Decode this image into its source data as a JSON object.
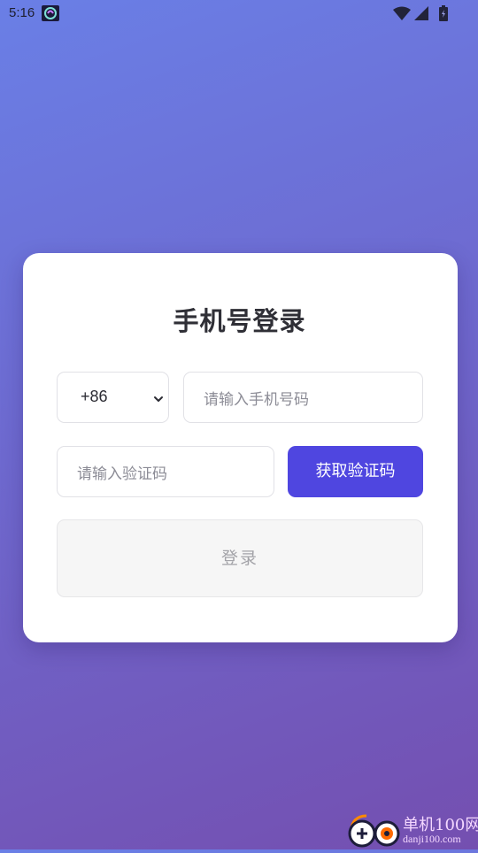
{
  "status_bar": {
    "time": "5:16",
    "app_icon": "app-notification-icon",
    "icons": [
      "wifi-icon",
      "cell-signal-icon",
      "battery-icon"
    ]
  },
  "login": {
    "title": "手机号登录",
    "country_code": "+86",
    "phone_placeholder": "请输入手机号码",
    "code_placeholder": "请输入验证码",
    "get_code_label": "获取验证码",
    "submit_label": "登录"
  },
  "watermark": {
    "name": "单机100网",
    "url": "danji100.com"
  },
  "colors": {
    "background_start": "#6a7fe6",
    "background_end": "#744fb0",
    "accent": "#4f46e0",
    "disabled_bg": "#f6f6f6",
    "disabled_text": "#a3a3a8"
  }
}
